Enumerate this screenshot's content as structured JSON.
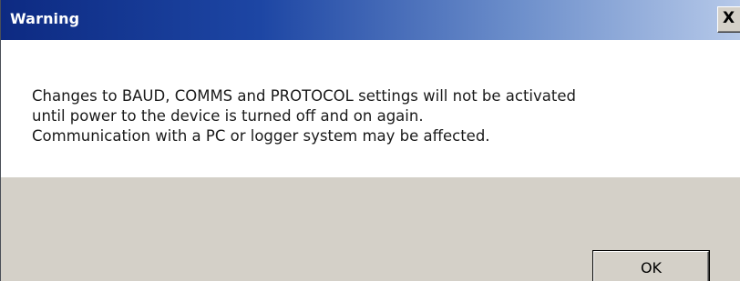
{
  "dialog": {
    "title": "Warning",
    "close_label": "X",
    "message_lines": [
      "Changes to BAUD, COMMS and PROTOCOL settings will not be activated",
      "until power to the device is turned off and on again.",
      "Communication with a PC or logger system may be affected."
    ],
    "ok_label": "OK"
  },
  "colors": {
    "titlebar_start": "#0d2a82",
    "titlebar_end": "#b6c9e9",
    "button_face": "#d4d0c8",
    "content_bg": "#ffffff"
  }
}
